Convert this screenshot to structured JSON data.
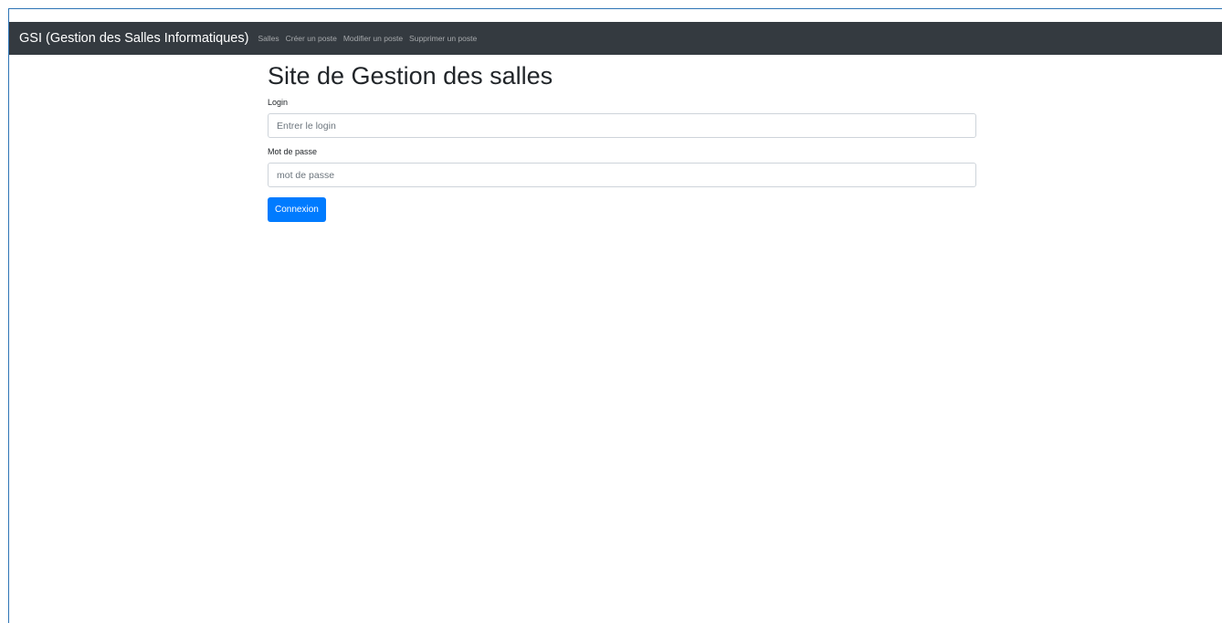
{
  "navbar": {
    "brand": "GSI (Gestion des Salles Informatiques)",
    "links": [
      {
        "label": "Salles"
      },
      {
        "label": "Créer un poste"
      },
      {
        "label": "Modifier un poste"
      },
      {
        "label": "Supprimer un poste"
      }
    ],
    "background_color": "#343a40"
  },
  "main": {
    "title": "Site de Gestion des salles",
    "login": {
      "label": "Login",
      "value": "",
      "placeholder": "Entrer le login"
    },
    "password": {
      "label": "Mot de passe",
      "value": "",
      "placeholder": "mot de passe"
    },
    "submit_label": "Connexion",
    "accent_color": "#007bff"
  }
}
